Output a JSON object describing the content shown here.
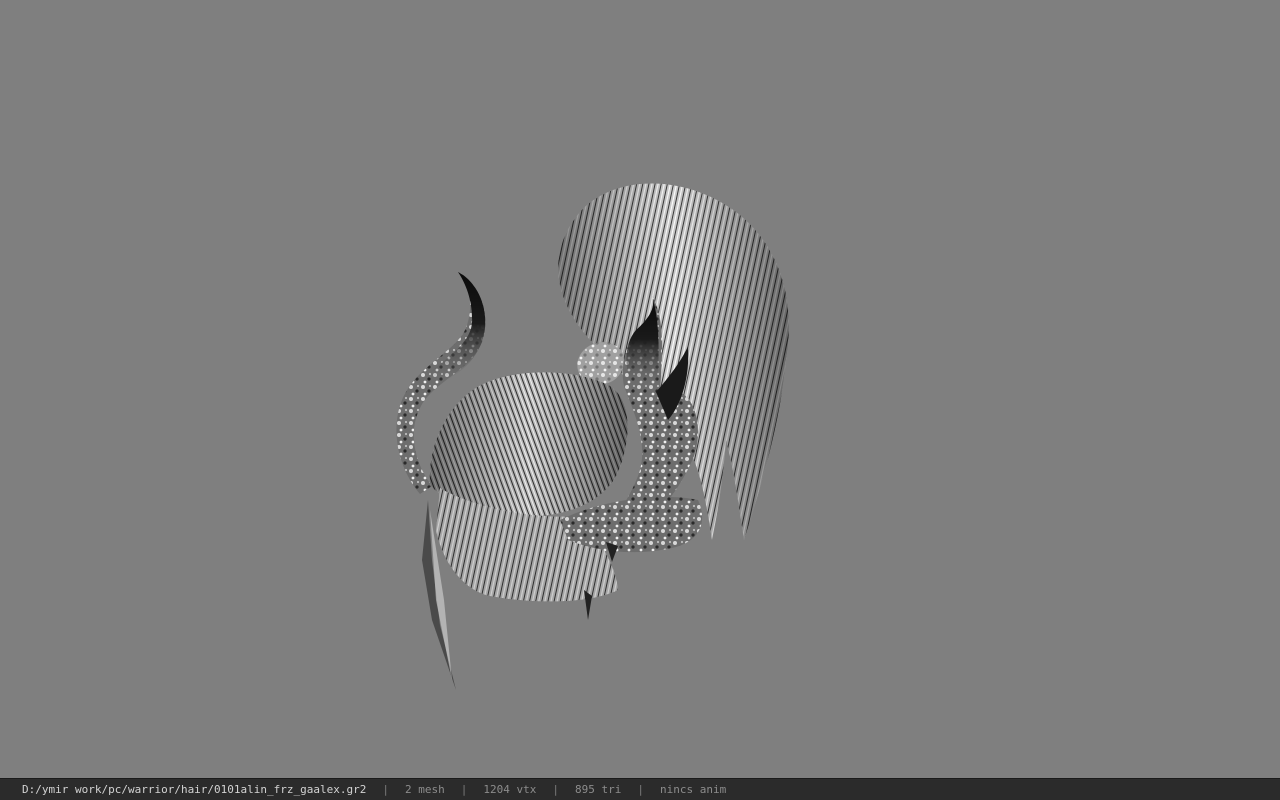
{
  "viewport": {
    "background_color": "#7f7f7f",
    "model_icon": "hair-mesh-icon"
  },
  "statusbar": {
    "file_path": "D:/ymir work/pc/warrior/hair/0101alin_frz_gaalex.gr2",
    "separator": "|",
    "mesh_count": "2 mesh",
    "vertex_count": "1204 vtx",
    "triangle_count": "895 tri",
    "anim_status": "nincs anim",
    "text_color": "#d2d2d2"
  }
}
